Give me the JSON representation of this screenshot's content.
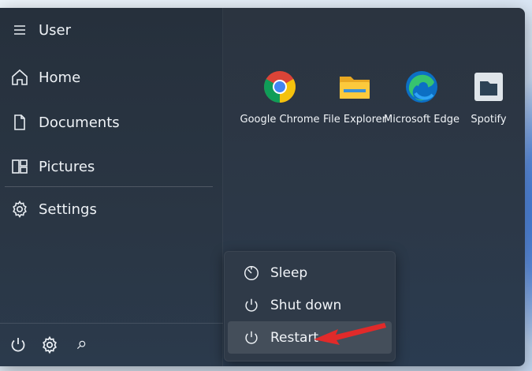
{
  "user": {
    "name": "User"
  },
  "nav": [
    {
      "label": "Home",
      "icon": "home-icon"
    },
    {
      "label": "Documents",
      "icon": "document-icon"
    },
    {
      "label": "Pictures",
      "icon": "pictures-icon"
    },
    {
      "label": "Settings",
      "icon": "gear-icon"
    }
  ],
  "apps": [
    {
      "label": "Google Chrome",
      "icon": "chrome-icon"
    },
    {
      "label": "File Explorer",
      "icon": "folder-icon"
    },
    {
      "label": "Microsoft Edge",
      "icon": "edge-icon"
    },
    {
      "label": "Spotify",
      "icon": "spotify-icon"
    }
  ],
  "power_menu": {
    "items": [
      {
        "label": "Sleep",
        "icon": "sleep-icon"
      },
      {
        "label": "Shut down",
        "icon": "power-icon"
      },
      {
        "label": "Restart",
        "icon": "restart-icon",
        "highlighted": true
      }
    ]
  },
  "bottom_bar": {
    "icons": [
      "power-icon",
      "gear-icon",
      "search-icon"
    ]
  },
  "colors": {
    "menu_bg": "#2b3440",
    "flyout_bg": "#2f3a48",
    "arrow": "#e12a2a"
  }
}
